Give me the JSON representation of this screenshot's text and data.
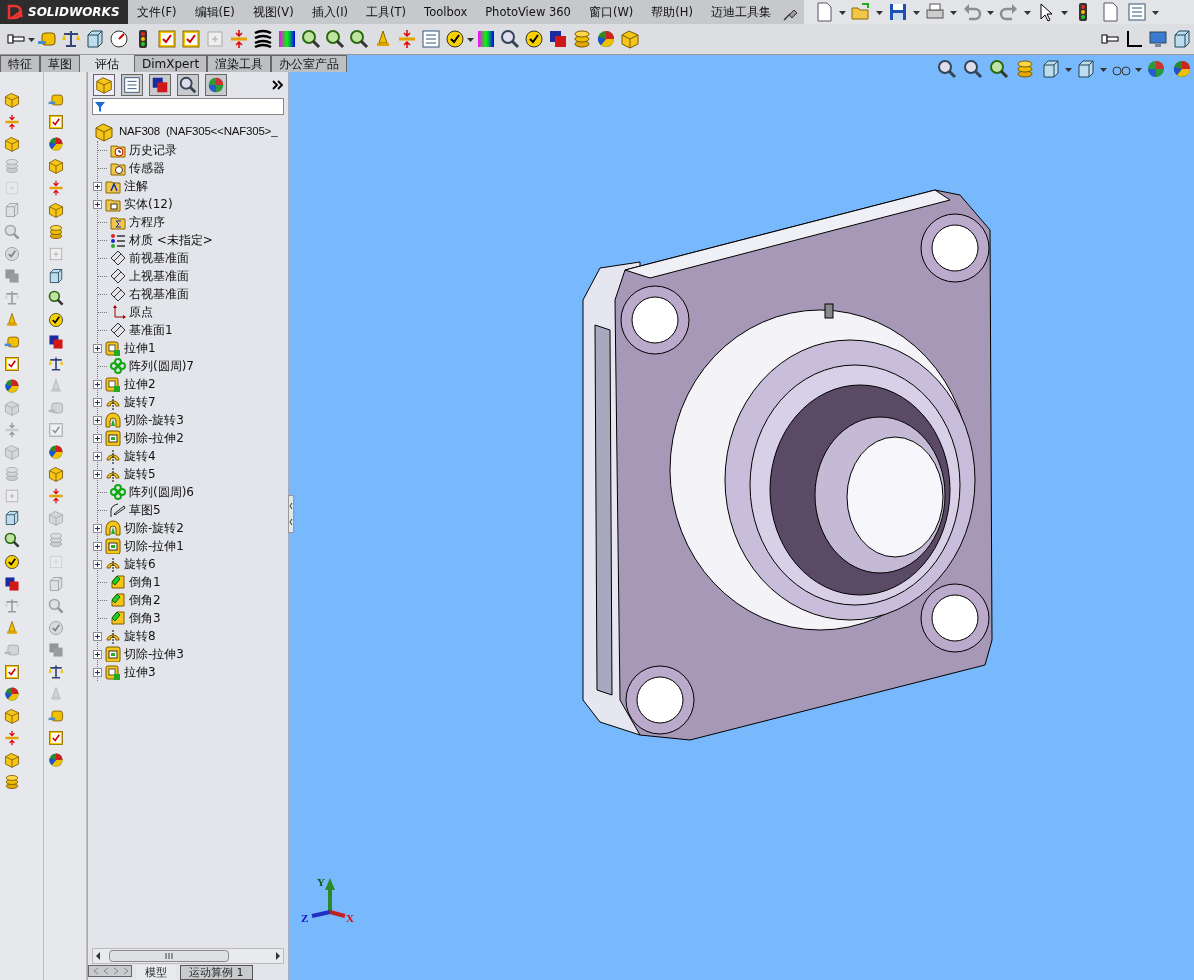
{
  "menu_bar": {
    "logo": "SOLIDWORKS",
    "items": [
      "文件(F)",
      "编辑(E)",
      "视图(V)",
      "插入(I)",
      "工具(T)",
      "Toolbox",
      "PhotoView 360",
      "窗口(W)",
      "帮助(H)",
      "迈迪工具集"
    ]
  },
  "command_tabs": [
    {
      "label": "特征",
      "selected": false
    },
    {
      "label": "草图",
      "selected": false
    },
    {
      "label": "评估",
      "selected": true
    },
    {
      "label": "DimXpert",
      "selected": false
    },
    {
      "label": "渲染工具",
      "selected": false
    },
    {
      "label": "办公室产品",
      "selected": false
    }
  ],
  "left_toolbars": [
    [
      {
        "disabled": false
      },
      {
        "disabled": false
      },
      {
        "disabled": false
      },
      {
        "disabled": true
      },
      {
        "disabled": true
      },
      {
        "disabled": true
      },
      {
        "disabled": true
      },
      {
        "disabled": true
      },
      {
        "disabled": true
      },
      {
        "disabled": true
      },
      {
        "disabled": false
      },
      {
        "disabled": false
      },
      {
        "disabled": false
      },
      {
        "disabled": false
      },
      {
        "disabled": true
      },
      {
        "disabled": true
      },
      {
        "disabled": true
      },
      {
        "disabled": true
      },
      {
        "disabled": false
      },
      {
        "disabled": false
      },
      {
        "disabled": false
      },
      {
        "disabled": false
      },
      {
        "disabled": false
      },
      {
        "disabled": true
      },
      {
        "disabled": false
      },
      {
        "disabled": true
      },
      {
        "disabled": false
      },
      {
        "disabled": false
      },
      {
        "disabled": false
      },
      {
        "disabled": false
      },
      {
        "disabled": false
      },
      {
        "disabled": false
      }
    ],
    [
      {
        "disabled": false
      },
      {
        "disabled": false
      },
      {
        "disabled": false
      },
      {
        "disabled": false
      },
      {
        "disabled": false
      },
      {
        "disabled": false
      },
      {
        "disabled": false
      },
      {
        "disabled": false
      },
      {
        "disabled": false
      },
      {
        "disabled": false
      },
      {
        "disabled": false
      },
      {
        "disabled": false
      },
      {
        "disabled": false
      },
      {
        "disabled": true
      },
      {
        "disabled": true
      },
      {
        "disabled": true
      },
      {
        "disabled": false
      },
      {
        "disabled": false
      },
      {
        "disabled": false
      },
      {
        "disabled": true
      },
      {
        "disabled": true
      },
      {
        "disabled": true
      },
      {
        "disabled": true
      },
      {
        "disabled": true
      },
      {
        "disabled": true
      },
      {
        "disabled": true
      },
      {
        "disabled": false
      },
      {
        "disabled": true
      },
      {
        "disabled": false
      },
      {
        "disabled": false
      },
      {
        "disabled": false
      }
    ]
  ],
  "feature_tree": {
    "root": "NAF308  (NAF305<<NAF305>_",
    "items": [
      {
        "label": "历史记录",
        "kind": "history",
        "expandable": false
      },
      {
        "label": "传感器",
        "kind": "sensor",
        "expandable": false
      },
      {
        "label": "注解",
        "kind": "annotation",
        "expandable": true
      },
      {
        "label": "实体(12)",
        "kind": "bodies",
        "expandable": true
      },
      {
        "label": "方程序",
        "kind": "equation",
        "expandable": false
      },
      {
        "label": "材质 <未指定>",
        "kind": "material",
        "expandable": false
      },
      {
        "label": "前视基准面",
        "kind": "plane",
        "expandable": false
      },
      {
        "label": "上视基准面",
        "kind": "plane",
        "expandable": false
      },
      {
        "label": "右视基准面",
        "kind": "plane",
        "expandable": false
      },
      {
        "label": "原点",
        "kind": "origin",
        "expandable": false
      },
      {
        "label": "基准面1",
        "kind": "plane",
        "expandable": false
      },
      {
        "label": "拉伸1",
        "kind": "extrude",
        "expandable": true
      },
      {
        "label": "阵列(圆周)7",
        "kind": "pattern",
        "expandable": false
      },
      {
        "label": "拉伸2",
        "kind": "extrude",
        "expandable": true
      },
      {
        "label": "旋转7",
        "kind": "revolve",
        "expandable": true
      },
      {
        "label": "切除-旋转3",
        "kind": "cut-revolve",
        "expandable": true
      },
      {
        "label": "切除-拉伸2",
        "kind": "cut-extrude",
        "expandable": true
      },
      {
        "label": "旋转4",
        "kind": "revolve",
        "expandable": true
      },
      {
        "label": "旋转5",
        "kind": "revolve",
        "expandable": true
      },
      {
        "label": "阵列(圆周)6",
        "kind": "pattern",
        "expandable": false
      },
      {
        "label": "草图5",
        "kind": "sketch",
        "expandable": false
      },
      {
        "label": "切除-旋转2",
        "kind": "cut-revolve",
        "expandable": true
      },
      {
        "label": "切除-拉伸1",
        "kind": "cut-extrude",
        "expandable": true
      },
      {
        "label": "旋转6",
        "kind": "revolve",
        "expandable": true
      },
      {
        "label": "倒角1",
        "kind": "chamfer",
        "expandable": false
      },
      {
        "label": "倒角2",
        "kind": "chamfer",
        "expandable": false
      },
      {
        "label": "倒角3",
        "kind": "chamfer",
        "expandable": false
      },
      {
        "label": "旋转8",
        "kind": "revolve",
        "expandable": true
      },
      {
        "label": "切除-拉伸3",
        "kind": "cut-extrude",
        "expandable": true
      },
      {
        "label": "拉伸3",
        "kind": "extrude",
        "expandable": true
      }
    ]
  },
  "triad": {
    "x": "X",
    "y": "Y",
    "z": "Z"
  },
  "bottom_tabs": [
    {
      "label": "模型",
      "selected": true
    },
    {
      "label": "运动算例 1",
      "selected": false
    }
  ]
}
